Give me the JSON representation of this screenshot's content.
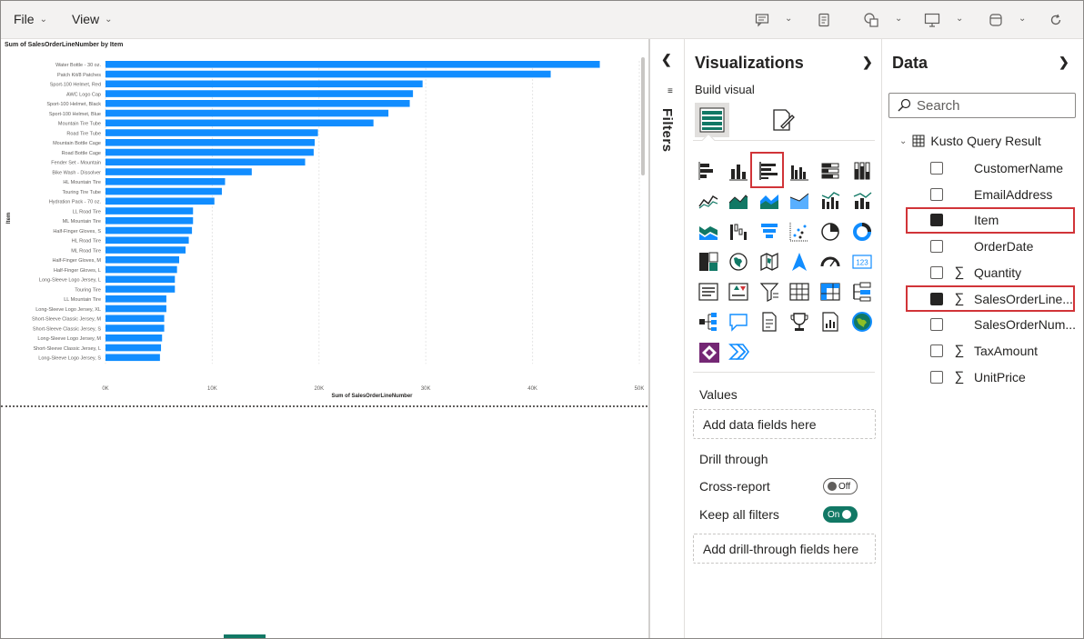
{
  "menu": {
    "file": "File",
    "view": "View"
  },
  "canvas": {
    "chart_title": "Sum of SalesOrderLineNumber by Item",
    "y_axis_label": "Item",
    "x_axis_label": "Sum of SalesOrderLineNumber"
  },
  "chart_data": {
    "type": "bar",
    "orientation": "horizontal",
    "title": "Sum of SalesOrderLineNumber by Item",
    "xlabel": "Sum of SalesOrderLineNumber",
    "ylabel": "Item",
    "xlim": [
      0,
      50000
    ],
    "xticks": [
      "0K",
      "10K",
      "20K",
      "30K",
      "40K",
      "50K"
    ],
    "bar_color": "#118dff",
    "grid": true,
    "categories": [
      "Water Bottle - 30 oz.",
      "Patch Kit/8 Patches",
      "Sport-100 Helmet, Red",
      "AWC Logo Cap",
      "Sport-100 Helmet, Black",
      "Sport-100 Helmet, Blue",
      "Mountain Tire Tube",
      "Road Tire Tube",
      "Mountain Bottle Cage",
      "Road Bottle Cage",
      "Fender Set - Mountain",
      "Bike Wash - Dissolver",
      "HL Mountain Tire",
      "Touring Tire Tube",
      "Hydration Pack - 70 oz.",
      "LL Road Tire",
      "ML Mountain Tire",
      "Half-Finger Gloves, S",
      "HL Road Tire",
      "ML Road Tire",
      "Half-Finger Gloves, M",
      "Half-Finger Gloves, L",
      "Long-Sleeve Logo Jersey, L",
      "Touring Tire",
      "LL Mountain Tire",
      "Long-Sleeve Logo Jersey, XL",
      "Short-Sleeve Classic Jersey, M",
      "Short-Sleeve Classic Jersey, S",
      "Long-Sleeve Logo Jersey, M",
      "Short-Sleeve Classic Jersey, L",
      "Long-Sleeve Logo Jersey, S"
    ],
    "values": [
      46300,
      41700,
      29700,
      28800,
      28500,
      26500,
      25100,
      19900,
      19600,
      19500,
      18700,
      13700,
      11200,
      10900,
      10200,
      8200,
      8200,
      8100,
      7800,
      7500,
      6900,
      6700,
      6500,
      6500,
      5700,
      5700,
      5500,
      5500,
      5300,
      5200,
      5100
    ]
  },
  "filters": {
    "label": "Filters"
  },
  "visualizations": {
    "title": "Visualizations",
    "build_visual": "Build visual",
    "values_label": "Values",
    "values_placeholder": "Add data fields here",
    "drill_through": "Drill through",
    "cross_report": "Cross-report",
    "cross_report_state": "Off",
    "keep_filters": "Keep all filters",
    "keep_filters_state": "On",
    "drill_placeholder": "Add drill-through fields here",
    "selected_visual": "clustered-bar-chart"
  },
  "data": {
    "title": "Data",
    "search_placeholder": "Search",
    "table_name": "Kusto Query Result",
    "fields": [
      {
        "name": "CustomerName",
        "sigma": false,
        "checked": false
      },
      {
        "name": "EmailAddress",
        "sigma": false,
        "checked": false
      },
      {
        "name": "Item",
        "sigma": false,
        "checked": true
      },
      {
        "name": "OrderDate",
        "sigma": false,
        "checked": false
      },
      {
        "name": "Quantity",
        "sigma": true,
        "checked": false
      },
      {
        "name": "SalesOrderLine...",
        "sigma": true,
        "checked": true
      },
      {
        "name": "SalesOrderNum...",
        "sigma": false,
        "checked": false
      },
      {
        "name": "TaxAmount",
        "sigma": true,
        "checked": false
      },
      {
        "name": "UnitPrice",
        "sigma": true,
        "checked": false
      }
    ]
  },
  "colors": {
    "accent": "#117865",
    "bar": "#118dff",
    "highlight": "#d13438"
  }
}
